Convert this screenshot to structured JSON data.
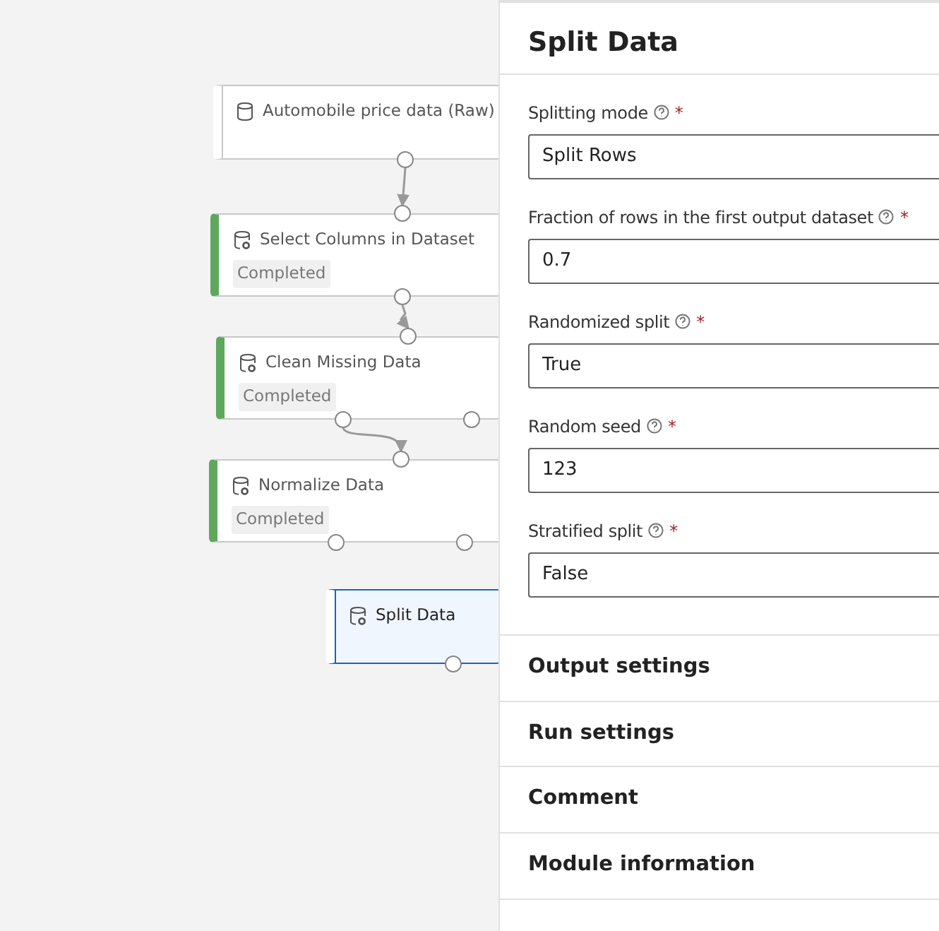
{
  "canvas": {
    "nodes": [
      {
        "title": "Automobile price data (Raw)",
        "kind": "dataset",
        "completed": false,
        "selected": false
      },
      {
        "title": "Select Columns in Dataset",
        "kind": "module",
        "completed": true,
        "status": "Completed",
        "selected": false
      },
      {
        "title": "Clean Missing Data",
        "kind": "module",
        "completed": true,
        "status": "Completed",
        "selected": false
      },
      {
        "title": "Normalize Data",
        "kind": "module",
        "completed": true,
        "status": "Completed",
        "selected": false
      },
      {
        "title": "Split Data",
        "kind": "module",
        "completed": false,
        "selected": true
      }
    ]
  },
  "panel": {
    "title": "Split Data",
    "fields": [
      {
        "label": "Splitting mode",
        "required_mark": "*",
        "value": "Split Rows"
      },
      {
        "label": "Fraction of rows in the first output dataset",
        "required_mark": "*",
        "value": "0.7"
      },
      {
        "label": "Randomized split",
        "required_mark": "*",
        "value": "True"
      },
      {
        "label": "Random seed",
        "required_mark": "*",
        "value": "123"
      },
      {
        "label": "Stratified split",
        "required_mark": "*",
        "value": "False"
      }
    ],
    "sections": [
      "Output settings",
      "Run settings",
      "Comment",
      "Module information"
    ]
  }
}
